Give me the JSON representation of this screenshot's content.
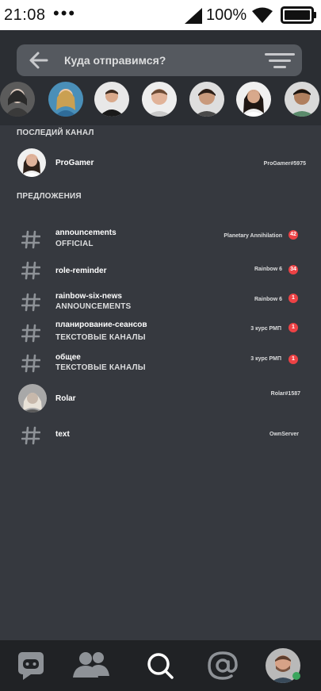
{
  "status_bar": {
    "time": "21:08",
    "dots": "•••",
    "battery_percent": "100%"
  },
  "search": {
    "placeholder": "Куда отправимся?",
    "value": ""
  },
  "stories": [
    {
      "name": "story-avatar-1"
    },
    {
      "name": "story-avatar-2"
    },
    {
      "name": "story-avatar-3"
    },
    {
      "name": "story-avatar-4"
    },
    {
      "name": "story-avatar-5"
    },
    {
      "name": "story-avatar-6"
    },
    {
      "name": "story-avatar-7"
    }
  ],
  "last_channel": {
    "title": "ПОСЛЕДИЙ КАНАЛ",
    "item": {
      "name": "ProGamer",
      "meta": "ProGamer#5975"
    }
  },
  "suggestions": {
    "title": "ПРЕДЛОЖЕНИЯ",
    "items": [
      {
        "title": "announcements",
        "subtitle": "OFFICIAL",
        "meta": "Planetary Annihilation",
        "badge": "42"
      },
      {
        "title": "role-reminder",
        "subtitle": "",
        "meta": "Rainbow 6",
        "badge": "34"
      },
      {
        "title": "rainbow-six-news",
        "subtitle": "ANNOUNCEMENTS",
        "meta": "Rainbow 6",
        "badge": "1"
      },
      {
        "title": "планирование-сеансов",
        "subtitle": "ТЕКСТОВЫЕ КАНАЛЫ",
        "meta": "3 курс РМП",
        "badge": "1"
      },
      {
        "title": "общее",
        "subtitle": "ТЕКСТОВЫЕ КАНАЛЫ",
        "meta": "3 курс РМП",
        "badge": "1"
      },
      {
        "title": "Rolar",
        "subtitle": "",
        "meta": "Rolar#1587",
        "badge": ""
      },
      {
        "title": "text",
        "subtitle": "",
        "meta": "OwnServer",
        "badge": ""
      }
    ]
  },
  "nav": {
    "items": [
      {
        "icon": "discord-icon"
      },
      {
        "icon": "friends-icon"
      },
      {
        "icon": "search-icon"
      },
      {
        "icon": "mentions-icon"
      },
      {
        "icon": "profile-avatar"
      }
    ]
  },
  "colors": {
    "background": "#36393f",
    "header": "#2b2e33",
    "badge": "#ed4245",
    "online": "#3ba55d"
  }
}
